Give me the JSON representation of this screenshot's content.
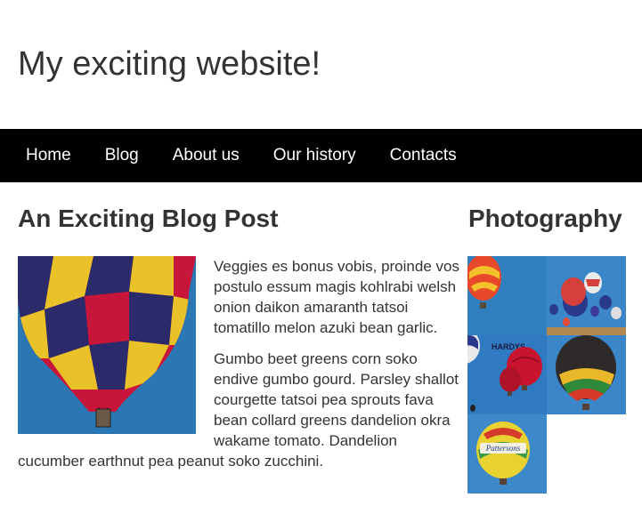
{
  "site": {
    "title": "My exciting website!"
  },
  "nav": {
    "items": [
      "Home",
      "Blog",
      "About us",
      "Our history",
      "Contacts"
    ]
  },
  "post": {
    "title": "An Exciting Blog Post",
    "paragraphs": [
      "Veggies es bonus vobis, proinde vos postulo essum magis kohlrabi welsh onion daikon amaranth tatsoi tomatillo melon azuki bean garlic.",
      "Gumbo beet greens corn soko endive gumbo gourd. Parsley shallot courgette tatsoi pea sprouts fava bean collard greens dandelion okra wakame tomato. Dandelion cucumber earthnut pea peanut soko zucchini."
    ]
  },
  "sidebar": {
    "title": "Photography",
    "thumb_labels": [
      "HARDYS",
      "Pattersons"
    ]
  },
  "colors": {
    "nav_bg": "#000000",
    "nav_text": "#ffffff",
    "text": "#333333",
    "sky": "#2a77b3"
  }
}
